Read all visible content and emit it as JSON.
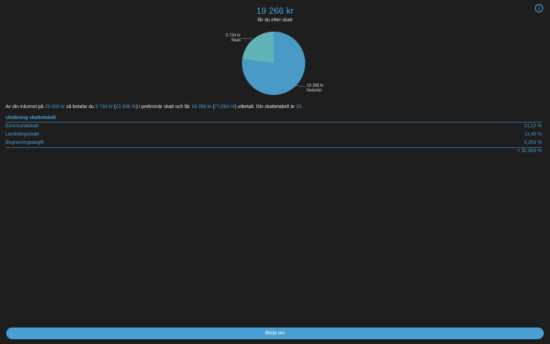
{
  "header": {
    "net_amount": "19 266 kr",
    "subtitle": "får du efter skatt"
  },
  "pie": {
    "tax_amount": "5 734 kr",
    "tax_label": "Skatt",
    "net_amount": "19 266 kr",
    "net_label": "Nettolön",
    "tax_fraction": 0.22936,
    "net_fraction": 0.77064,
    "tax_color": "#62b3b6",
    "net_color": "#4a9ac7"
  },
  "summary": {
    "part1": "Av din inkomst på ",
    "income": "25 000 kr",
    "part2": " så betalar du ",
    "tax": "5 734 kr",
    "part3": " (",
    "tax_percent": "22,936 %",
    "part4": ") i preliminär skatt och får ",
    "net": "19 266 kr",
    "part5": " (",
    "net_percent": "77,064 %",
    "part6": ") utbetalt. Din skattetabell är ",
    "table_no": "33",
    "part7": "."
  },
  "table": {
    "title": "Uträkning skattetabell",
    "rows": [
      {
        "label": "Kommunalskatt",
        "value": "21,12 %"
      },
      {
        "label": "Landstingsskatt",
        "value": "11,48 %"
      },
      {
        "label": "Begravningsavgift",
        "value": "0,253 %"
      }
    ],
    "total": "= 32,853 %"
  },
  "restart_label": "Börja om",
  "accent_color": "#4a9fd4",
  "info_icon": "info-circle-icon"
}
